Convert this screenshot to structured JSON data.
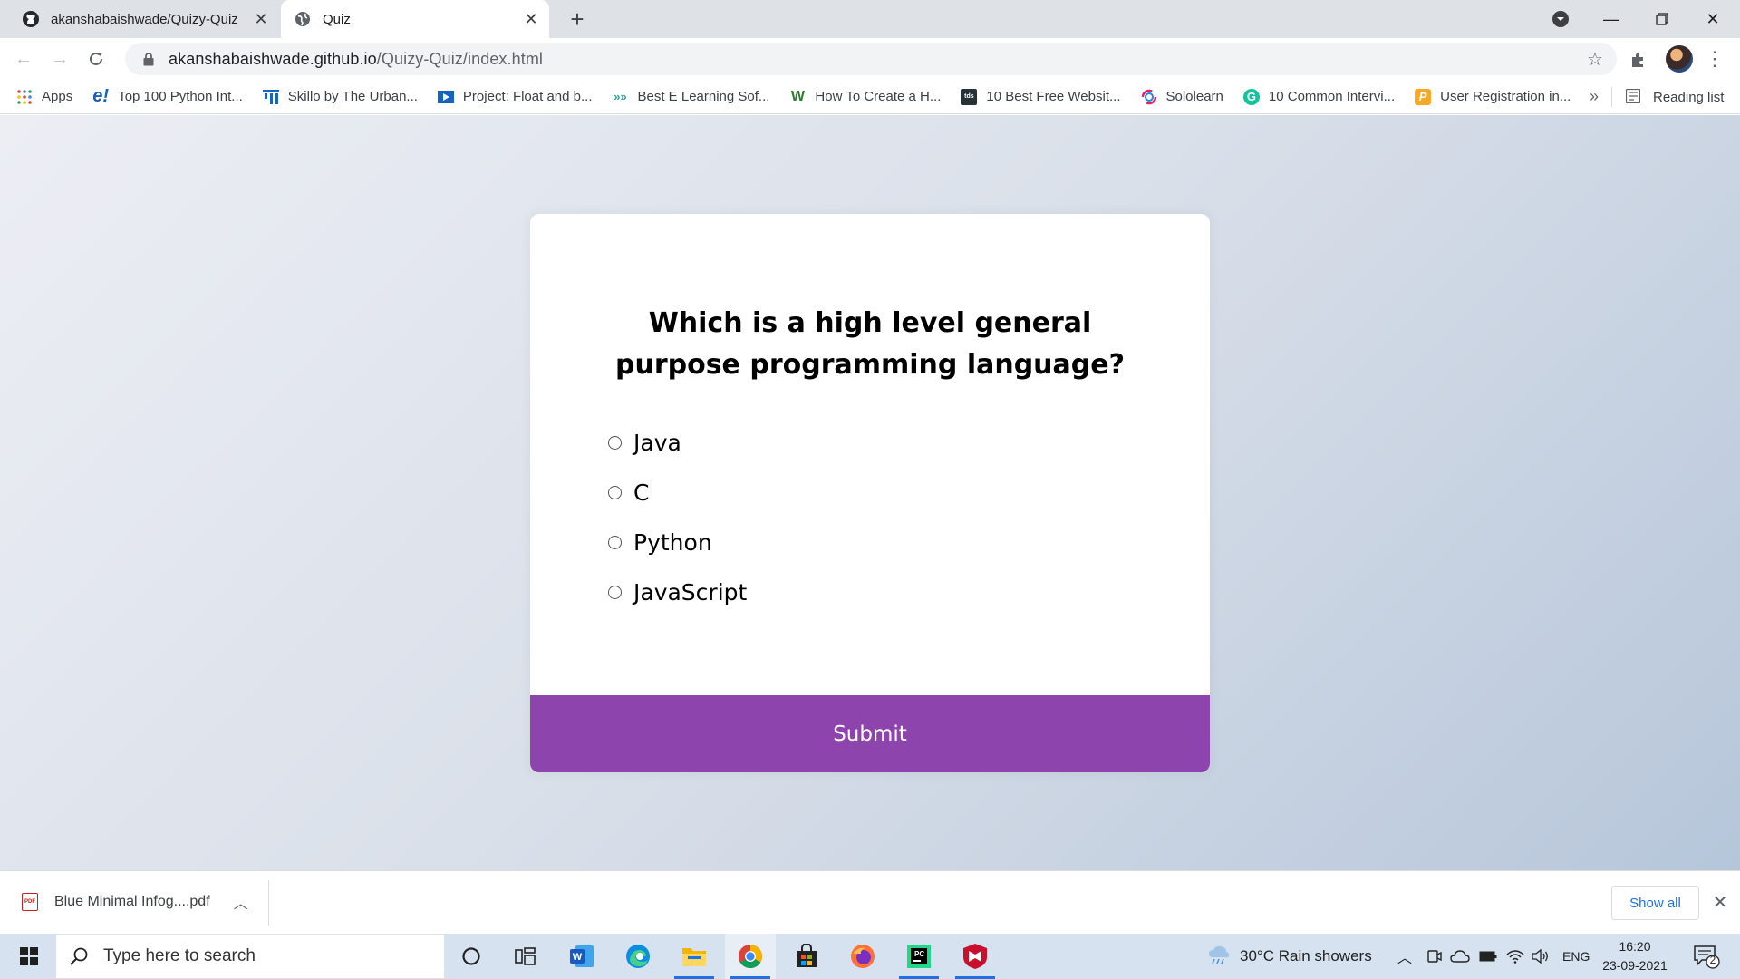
{
  "browser": {
    "tabs": [
      {
        "title": "akanshabaishwade/Quizy-Quiz",
        "active": false,
        "icon": "github-icon"
      },
      {
        "title": "Quiz",
        "active": true,
        "icon": "globe-icon"
      }
    ],
    "url_host": "akanshabaishwade.github.io",
    "url_path": "/Quizy-Quiz/index.html"
  },
  "bookmarks": [
    {
      "label": "Apps",
      "icon": "apps-grid-icon"
    },
    {
      "label": "Top 100 Python Int...",
      "icon": "e-icon"
    },
    {
      "label": "Skillo by The Urban...",
      "icon": "skillo-icon"
    },
    {
      "label": "Project: Float and b...",
      "icon": "video-icon"
    },
    {
      "label": "Best E Learning Sof...",
      "icon": "chevrons-icon"
    },
    {
      "label": "How To Create a H...",
      "icon": "w-icon"
    },
    {
      "label": "10 Best Free Websit...",
      "icon": "tds-icon"
    },
    {
      "label": "Sololearn",
      "icon": "sololearn-icon"
    },
    {
      "label": "10 Common Intervi...",
      "icon": "g-icon"
    },
    {
      "label": "User Registration in...",
      "icon": "p-icon"
    }
  ],
  "reading_list": "Reading list",
  "quiz": {
    "question": "Which is a high level general purpose programming language?",
    "answers": [
      "Java",
      "C",
      "Python",
      "JavaScript"
    ],
    "submit_label": "Submit",
    "accent_color": "#8e44ad"
  },
  "downloads": {
    "file": "Blue Minimal Infog....pdf",
    "show_all": "Show all"
  },
  "taskbar": {
    "search_placeholder": "Type here to search",
    "weather": "30°C  Rain showers",
    "language": "ENG",
    "time": "16:20",
    "date": "23-09-2021",
    "notification_count": "2"
  }
}
